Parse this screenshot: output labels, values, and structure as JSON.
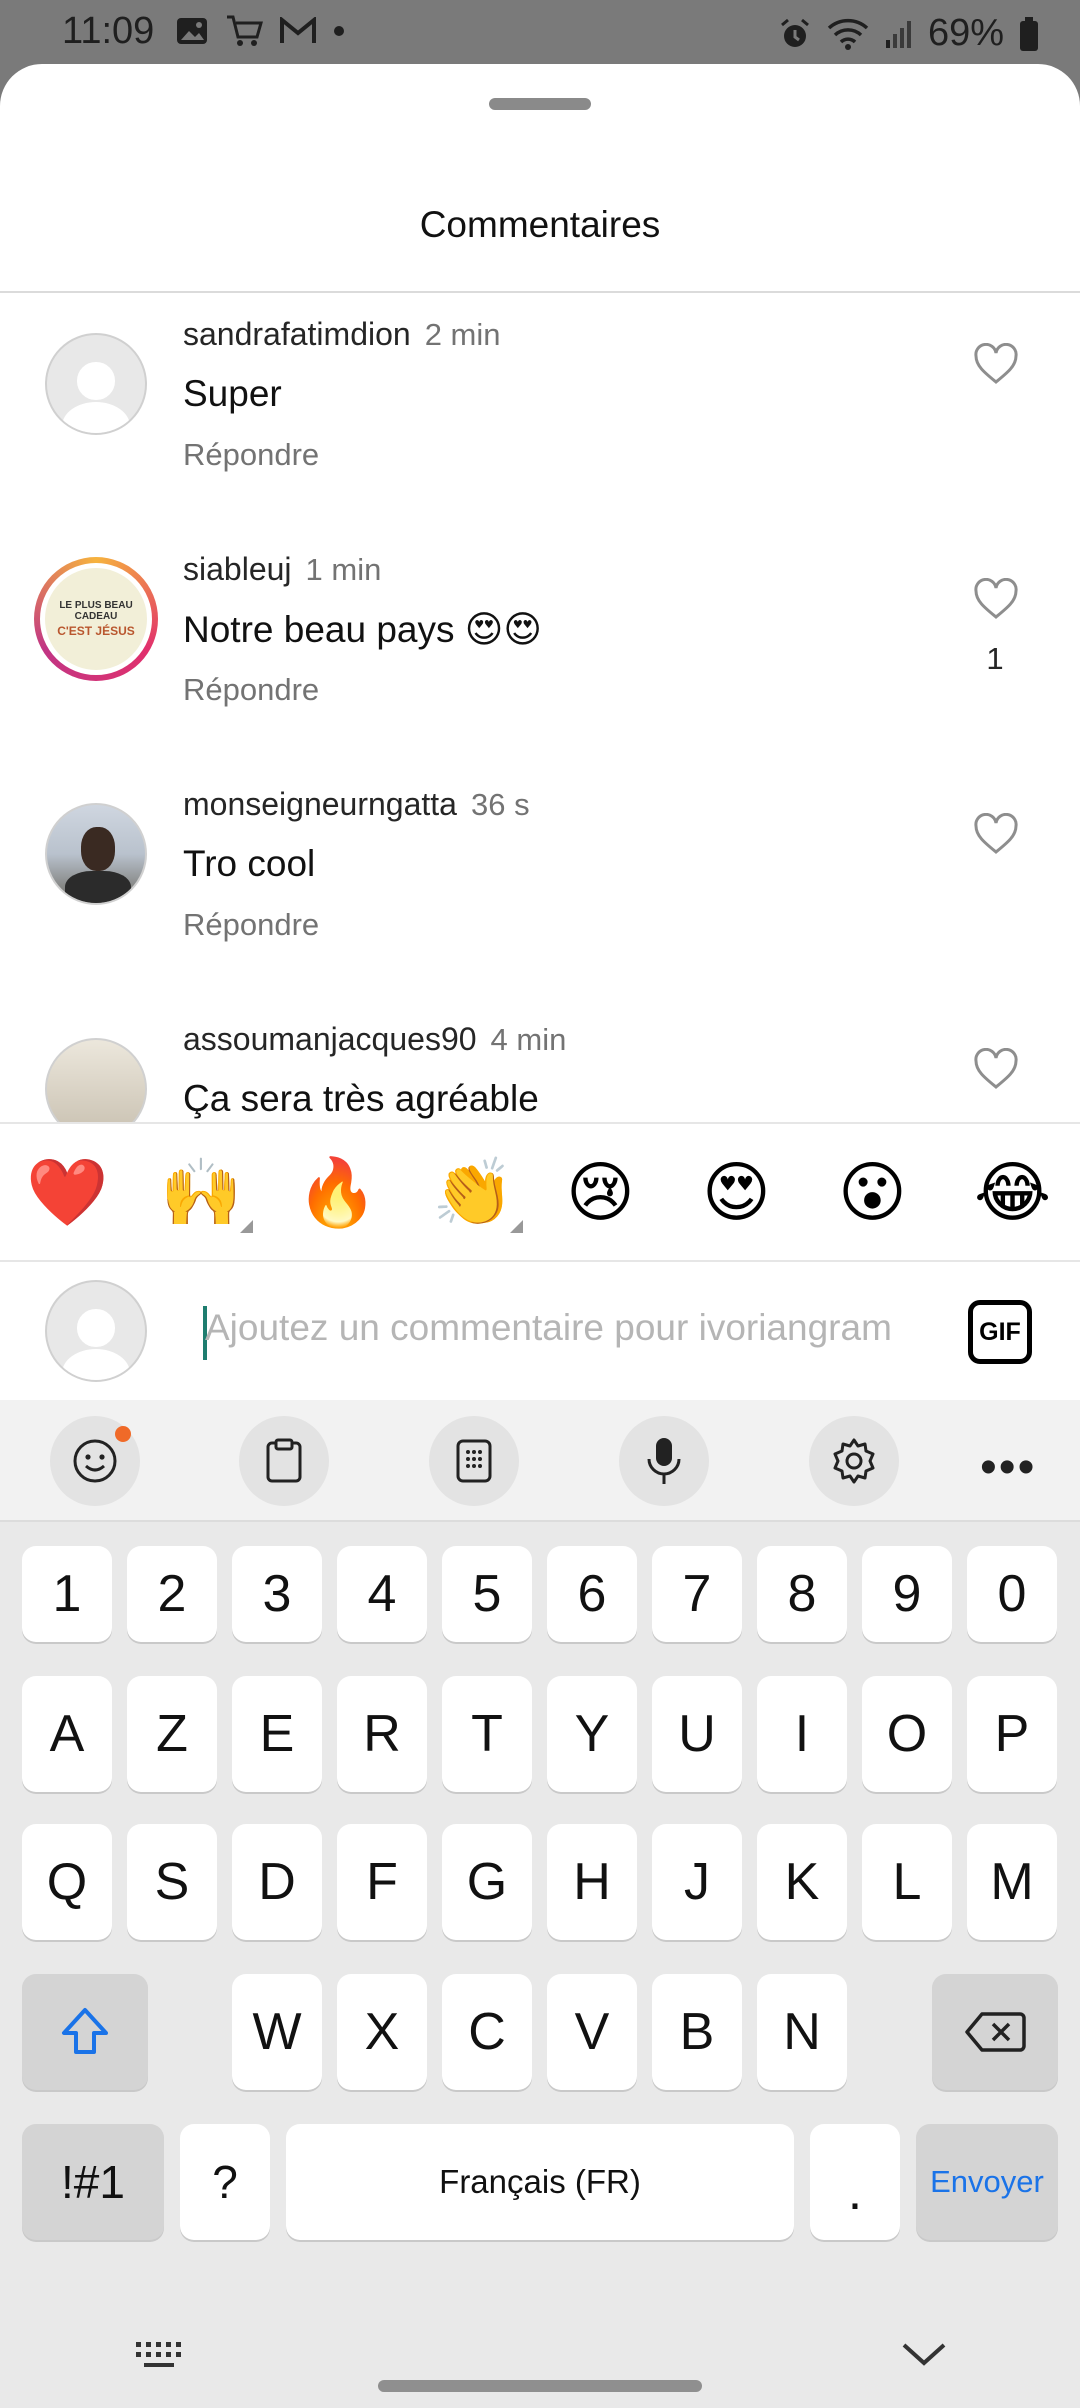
{
  "status_bar": {
    "time": "11:09",
    "battery": "69%",
    "left_icons": [
      "image-icon",
      "cart-icon",
      "gmail-icon",
      "dot-icon"
    ],
    "right_icons": [
      "alarm-icon",
      "wifi-icon",
      "signal-icon",
      "battery-icon"
    ]
  },
  "sheet": {
    "title": "Commentaires"
  },
  "comments": [
    {
      "username": "sandrafatimdion",
      "time": "2 min",
      "text": "Super",
      "reply": "Répondre",
      "likes": "",
      "avatar": "default"
    },
    {
      "username": "siableuj",
      "time": "1 min",
      "text": "Notre beau pays 😍😍",
      "reply": "Répondre",
      "likes": "1",
      "avatar": "story-ring",
      "avatar_text1": "LE PLUS BEAU CADEAU",
      "avatar_text2": "C'EST JÉSUS"
    },
    {
      "username": "monseigneurngatta",
      "time": "36 s",
      "text": "Tro cool",
      "reply": "Répondre",
      "likes": "",
      "avatar": "photo"
    },
    {
      "username": "assoumanjacques90",
      "time": "4 min",
      "text": "Ça sera très agréable",
      "reply": "Répondre",
      "likes": "",
      "avatar": "photo-tree"
    }
  ],
  "emoji_bar": [
    "❤️",
    "🙌",
    "🔥",
    "👏",
    "😢",
    "😍",
    "😮",
    "😂"
  ],
  "comment_input": {
    "placeholder": "Ajoutez un commentaire pour ivoriangram",
    "gif_label": "GIF"
  },
  "keyboard": {
    "toolbar": [
      "emoji-icon",
      "clipboard-icon",
      "numpad-icon",
      "mic-icon",
      "settings-icon",
      "more-icon"
    ],
    "row_numbers": [
      "1",
      "2",
      "3",
      "4",
      "5",
      "6",
      "7",
      "8",
      "9",
      "0"
    ],
    "row1": [
      "A",
      "Z",
      "E",
      "R",
      "T",
      "Y",
      "U",
      "I",
      "O",
      "P"
    ],
    "row2": [
      "Q",
      "S",
      "D",
      "F",
      "G",
      "H",
      "J",
      "K",
      "L",
      "M"
    ],
    "row3": [
      "W",
      "X",
      "C",
      "V",
      "B",
      "N"
    ],
    "symbols_key": "!#1",
    "question_key": "?",
    "space_label": "Français (FR)",
    "period_key": ".",
    "send_label": "Envoyer",
    "send_color": "#1a73e8"
  }
}
